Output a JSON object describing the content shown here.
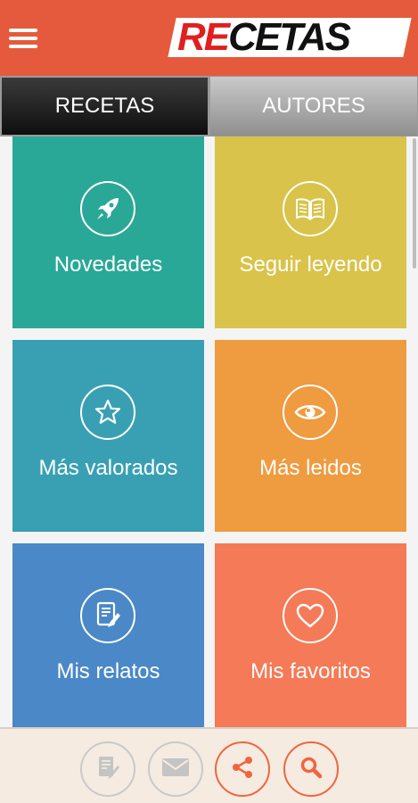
{
  "header": {
    "logo_highlight": "RE",
    "logo_rest": "CETAS",
    "menu_icon": "hamburger-menu-icon",
    "bar_color": "#e55a3c"
  },
  "tabs": [
    {
      "label": "RECETAS",
      "selected": true
    },
    {
      "label": "AUTORES",
      "selected": false
    }
  ],
  "tiles": [
    {
      "label": "Novedades",
      "icon": "rocket-icon",
      "color": "#2aa897"
    },
    {
      "label": "Seguir leyendo",
      "icon": "open-book-icon",
      "color": "#d9c34a"
    },
    {
      "label": "Más valorados",
      "icon": "star-icon",
      "color": "#39a0b3"
    },
    {
      "label": "Más leidos",
      "icon": "eye-icon",
      "color": "#ef9b3f"
    },
    {
      "label": "Mis relatos",
      "icon": "document-edit-icon",
      "color": "#4a88c7"
    },
    {
      "label": "Mis favoritos",
      "icon": "heart-icon",
      "color": "#f57a57"
    }
  ],
  "footer": {
    "buttons": [
      {
        "icon": "write-document-icon",
        "enabled": false
      },
      {
        "icon": "envelope-icon",
        "enabled": false
      },
      {
        "icon": "share-icon",
        "enabled": true
      },
      {
        "icon": "search-icon",
        "enabled": true
      }
    ],
    "accent_color": "#f0653f"
  }
}
